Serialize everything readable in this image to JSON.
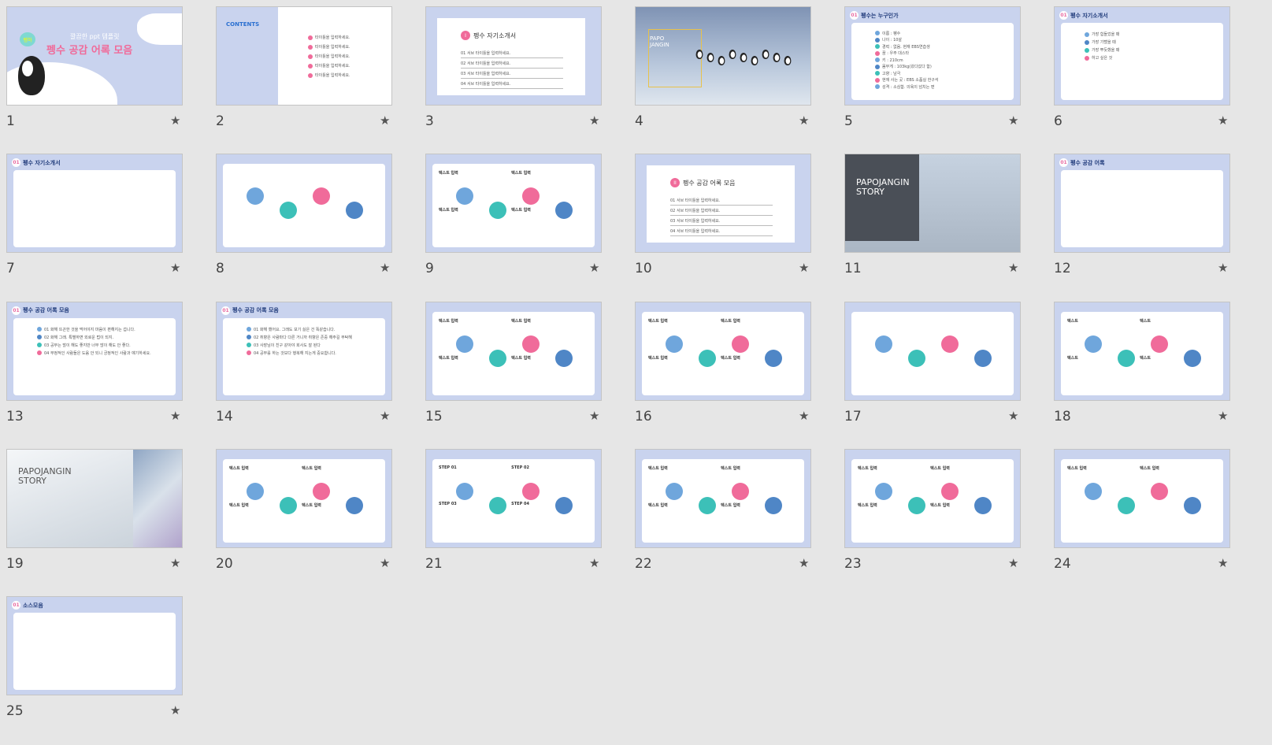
{
  "view": "slide-sorter",
  "star_icon": "star-icon",
  "slides": [
    {
      "num": "1",
      "variant": "cover",
      "subtitle": "깔끔한 ppt 템플릿",
      "title": "펭수 공감 어록 모음",
      "bubble": "펭하"
    },
    {
      "num": "2",
      "variant": "contents",
      "title": "CONTENTS",
      "lines": [
        "타이틀을 입력하세요.",
        "타이틀을 입력하세요.",
        "타이틀을 입력하세요.",
        "타이틀을 입력하세요.",
        "타이틀을 입력하세요."
      ]
    },
    {
      "num": "3",
      "variant": "section",
      "mark": "I",
      "title": "펭수 자기소개서",
      "lines": [
        "01  서브 타이틀을 입력하세요.",
        "02  서브 타이틀을 입력하세요.",
        "03  서브 타이틀을 입력하세요.",
        "04  서브 타이틀을 입력하세요."
      ]
    },
    {
      "num": "4",
      "variant": "photo",
      "title": "PAPO JANGIN"
    },
    {
      "num": "5",
      "variant": "content",
      "badge": "01",
      "title": "펭수는 누구인가",
      "lines": [
        "이름 : 펭수",
        "나이 : 10살",
        "경력 : 없음. 현재 EBS연습생",
        "꿈 : 우주 대스타",
        "키 : 210cm",
        "몸무게 : 103kg(왔다갔다 함)",
        "고향 : 남극",
        "현재 사는 곳 : EBS 소품실 한구석",
        "성격 : 소심함. 의욕이 넘치는 편"
      ]
    },
    {
      "num": "6",
      "variant": "content",
      "badge": "01",
      "title": "펭수 자기소개서",
      "lines": [
        "가장 힘들었을 때",
        "가장 기뻤을 때",
        "가장 뿌듯했을 때",
        "하고 싶은 것"
      ]
    },
    {
      "num": "7",
      "variant": "content",
      "badge": "01",
      "title": "펭수 자기소개서",
      "lines": []
    },
    {
      "num": "8",
      "variant": "diagram",
      "lines": []
    },
    {
      "num": "9",
      "variant": "diagram",
      "lines": [
        "텍스트 입력",
        "텍스트 입력",
        "텍스트 입력",
        "텍스트 입력"
      ]
    },
    {
      "num": "10",
      "variant": "section",
      "mark": "II",
      "title": "펭수 공감 어록 모음",
      "lines": [
        "01  서브 타이틀을 입력하세요.",
        "02  서브 타이틀을 입력하세요.",
        "03  서브 타이틀을 입력하세요.",
        "04  서브 타이틀을 입력하세요."
      ]
    },
    {
      "num": "11",
      "variant": "dark",
      "title": "PAPOJANGIN STORY"
    },
    {
      "num": "12",
      "variant": "content",
      "badge": "01",
      "title": "펭수 공감 어록",
      "lines": []
    },
    {
      "num": "13",
      "variant": "content",
      "badge": "01",
      "title": "펭수 공감 어록 모음",
      "lines": [
        "01  화해 뜨끈한 것을 먹어야지 마음이 편해지는 겁니다.",
        "02  화해 그래. 특별하면 외로운 법이 되지.",
        "03  공부는 많이 해도 좋지만 너무 많이 해도 안 좋다.",
        "04  부정적인 사람들은 도움 안 되니 긍정적인 사람과 얘기하세요."
      ]
    },
    {
      "num": "14",
      "variant": "content",
      "badge": "01",
      "title": "펭수 공감 어록 모음",
      "lines": [
        "01  화해 했어요. 그래도 보기 싫은 건 똑같습니다.",
        "02  취향은 사람마다 다른 거니까 취향은 존중 해주길 부탁해",
        "03  사장님이 친구 같아야 회사도 잘 된다",
        "04  공부를 하는 것보다 행복해 지는게 중요합니다."
      ]
    },
    {
      "num": "15",
      "variant": "diagram",
      "lines": [
        "텍스트 입력",
        "텍스트 입력",
        "텍스트 입력",
        "텍스트 입력"
      ]
    },
    {
      "num": "16",
      "variant": "diagram",
      "lines": [
        "텍스트 입력",
        "텍스트 입력",
        "텍스트 입력",
        "텍스트 입력"
      ]
    },
    {
      "num": "17",
      "variant": "diagram",
      "lines": []
    },
    {
      "num": "18",
      "variant": "diagram",
      "lines": [
        "텍스트",
        "텍스트",
        "텍스트",
        "텍스트"
      ]
    },
    {
      "num": "19",
      "variant": "mountain",
      "title": "PAPOJANGIN STORY"
    },
    {
      "num": "20",
      "variant": "diagram",
      "lines": [
        "텍스트 입력",
        "텍스트 입력",
        "텍스트 입력",
        "텍스트 입력"
      ]
    },
    {
      "num": "21",
      "variant": "diagram",
      "lines": [
        "STEP 01",
        "STEP 02",
        "STEP 03",
        "STEP 04"
      ]
    },
    {
      "num": "22",
      "variant": "diagram",
      "lines": [
        "텍스트 입력",
        "텍스트 입력",
        "텍스트 입력",
        "텍스트 입력"
      ]
    },
    {
      "num": "23",
      "variant": "diagram",
      "lines": [
        "텍스트 입력",
        "텍스트 입력",
        "텍스트 입력",
        "텍스트 입력"
      ]
    },
    {
      "num": "24",
      "variant": "diagram",
      "lines": [
        "텍스트 입력",
        "텍스트 입력"
      ]
    },
    {
      "num": "25",
      "variant": "content",
      "badge": "01",
      "title": "소스모음",
      "lines": []
    }
  ],
  "colors": {
    "lavender": "#c9d3ee",
    "pink": "#f06b9a",
    "teal": "#3cc0b8",
    "blue": "#6fa6dc",
    "navy": "#1f3a7a"
  }
}
